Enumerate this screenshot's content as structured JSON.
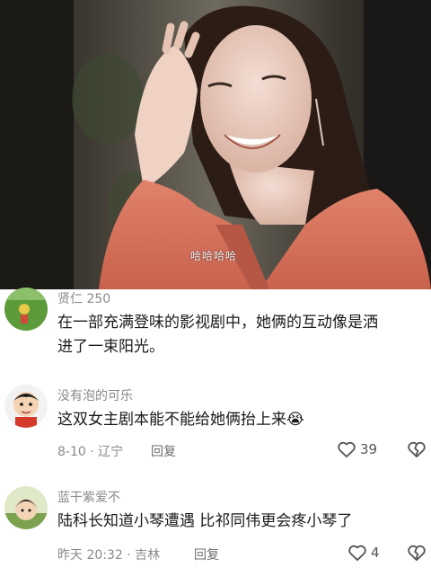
{
  "photo": {
    "subtitle": "哈哈哈哈"
  },
  "comments": [
    {
      "username": "贤仁 250",
      "text_line1": "在一部充满登味的影视剧中，她俩的互动像是洒",
      "text_line2": "进了一束阳光。"
    },
    {
      "username": "没有泡的可乐",
      "text": "这双女主剧本能不能给她俩抬上来",
      "emoji": "😭",
      "meta": "8-10 · 辽宁",
      "reply_label": "回复",
      "likes": "39"
    },
    {
      "username": "蓝干紫爱不",
      "text": "陆科长知道小琴遭遇 比祁同伟更会疼小琴了",
      "meta": "昨天 20:32 · 吉林",
      "reply_label": "回复",
      "likes": "4"
    }
  ],
  "colors": {
    "username": "#8a8a8a",
    "text": "#1a1a1a",
    "blazer": "#d9735e"
  }
}
